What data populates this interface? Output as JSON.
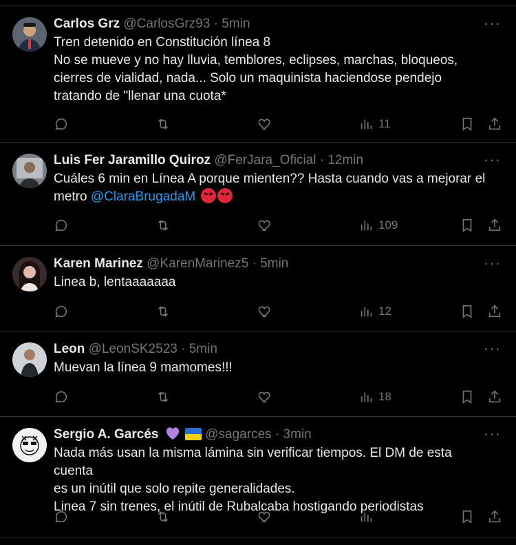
{
  "tweets": [
    {
      "name": "Carlos Grz",
      "handle": "@CarlosGrz93",
      "time": "5min",
      "lines": [
        "Tren detenido en Constitución línea 8",
        "No se mueve y no hay lluvia, temblores, eclipses, marchas, bloqueos,",
        "cierres de vialidad, nada... Solo un maquinista haciendose pendejo",
        "tratando de \"llenar una cuota*"
      ],
      "views": "11"
    },
    {
      "name": "Luis Fer Jaramillo Quiroz",
      "handle": "@FerJara_Oficial",
      "time": "12min",
      "line1": "Cuáles 6 min en Línea A porque mienten?? Hasta cuando vas a mejorar el",
      "line2_prefix": "metro ",
      "mention": "@ClaraBrugadaM",
      "views": "109"
    },
    {
      "name": "Karen Marinez",
      "handle": "@KarenMarinez5",
      "time": "5min",
      "lines": [
        "Linea b, lentaaaaaaa"
      ],
      "views": "12"
    },
    {
      "name": "Leon",
      "handle": "@LeonSK2523",
      "time": "5min",
      "lines": [
        "Muevan la línea 9 mamomes!!!"
      ],
      "views": "18"
    },
    {
      "name": "Sergio A. Garcés",
      "handle": "@sagarces",
      "time": "3min",
      "lines": [
        "Nada más usan la misma lámina sin verificar tiempos. El DM de esta cuenta",
        "es un inútil que solo repite generalidades.",
        "Linea 7 sin trenes, el inútil de Rubalcaba hostigando periodistas"
      ],
      "views": ""
    }
  ],
  "separator": "·",
  "more_glyph": "···",
  "colors": {
    "background": "#000000",
    "text": "#e7e9ea",
    "muted": "#71767b",
    "link": "#1d9bf0",
    "border": "#2f3336"
  },
  "icons": [
    "reply-icon",
    "retweet-icon",
    "like-icon",
    "views-icon",
    "bookmark-icon",
    "share-icon",
    "more-icon"
  ]
}
